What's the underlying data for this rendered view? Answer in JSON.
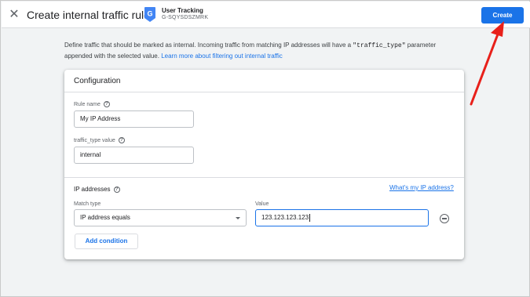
{
  "header": {
    "close_icon": "close-icon",
    "title": "Create internal traffic rule",
    "property_icon": "analytics-property-badge",
    "property_icon_letter": "G",
    "property_name": "User Tracking",
    "property_id": "G-SQYSDSZMRK",
    "create_label": "Create",
    "accent_color": "#1a73e8"
  },
  "description": {
    "text_before": "Define traffic that should be marked as internal. Incoming traffic from matching IP addresses will have a ",
    "code": "\"traffic_type\"",
    "text_after": " parameter appended with the selected value. ",
    "link": "Learn more about filtering out internal traffic"
  },
  "configuration": {
    "title": "Configuration",
    "rule_name_label": "Rule name",
    "rule_name_value": "My IP Address",
    "traffic_type_label": "traffic_type value",
    "traffic_type_value": "internal",
    "help_icon": "help-icon"
  },
  "ip_addresses": {
    "title": "IP addresses",
    "whats_my_ip_link": "What's my IP address?",
    "match_type_label": "Match type",
    "match_type_value": "IP address equals",
    "value_label": "Value",
    "value": "123.123.123.123",
    "remove_icon": "remove-circle-icon",
    "add_condition_label": "Add condition"
  },
  "annotation": {
    "arrow_color": "#e8201a"
  }
}
